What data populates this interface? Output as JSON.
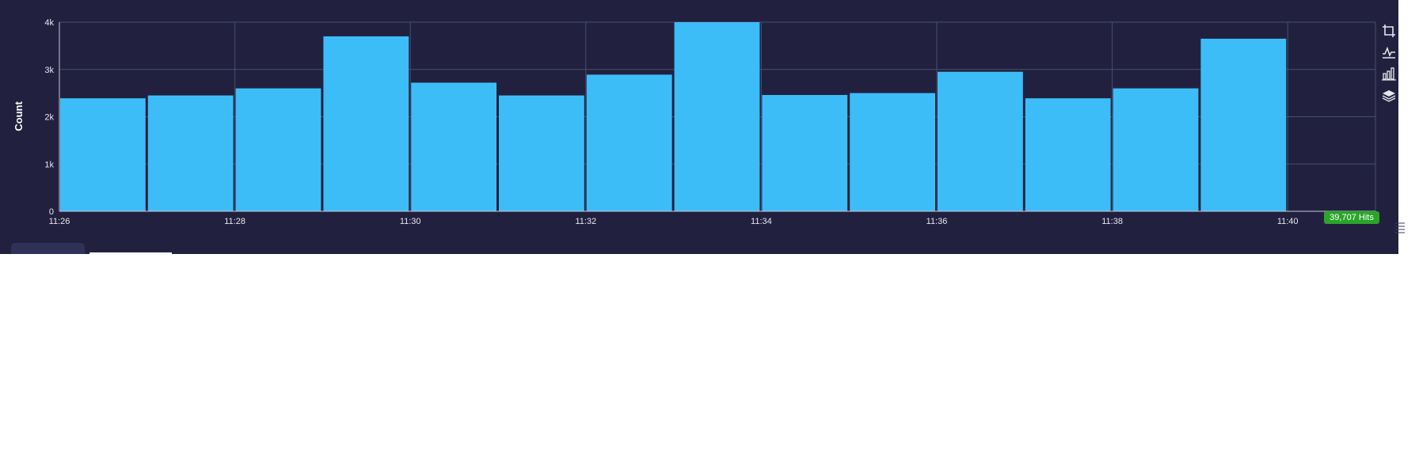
{
  "chart_data": {
    "type": "bar",
    "ylabel": "Count",
    "xlabel": "",
    "title": "",
    "ylim": [
      0,
      4000
    ],
    "yticks": [
      {
        "value": 0,
        "label": "0"
      },
      {
        "value": 1000,
        "label": "1k"
      },
      {
        "value": 2000,
        "label": "2k"
      },
      {
        "value": 3000,
        "label": "3k"
      },
      {
        "value": 4000,
        "label": "4k"
      }
    ],
    "xticks": [
      "11:26",
      "11:28",
      "11:30",
      "11:32",
      "11:34",
      "11:36",
      "11:38",
      "11:40"
    ],
    "categories": [
      "11:26",
      "11:27",
      "11:28",
      "11:29",
      "11:30",
      "11:31",
      "11:32",
      "11:33",
      "11:34",
      "11:35",
      "11:36",
      "11:37",
      "11:38",
      "11:39",
      "11:40"
    ],
    "values": [
      2390,
      2450,
      2600,
      3700,
      2720,
      2450,
      2890,
      4000,
      2460,
      2500,
      2950,
      2390,
      2600,
      3650,
      0
    ],
    "grid": true,
    "colors": {
      "bar": "#3dbdf7",
      "background": "#21213f",
      "grid": "#4a4c70",
      "text": "#e6e6ee"
    }
  },
  "summary": {
    "hits_label": "39,707 Hits"
  },
  "toolbar": {
    "icons": [
      "crop-icon",
      "line-chart-icon",
      "bar-chart-icon",
      "layers-icon"
    ]
  }
}
